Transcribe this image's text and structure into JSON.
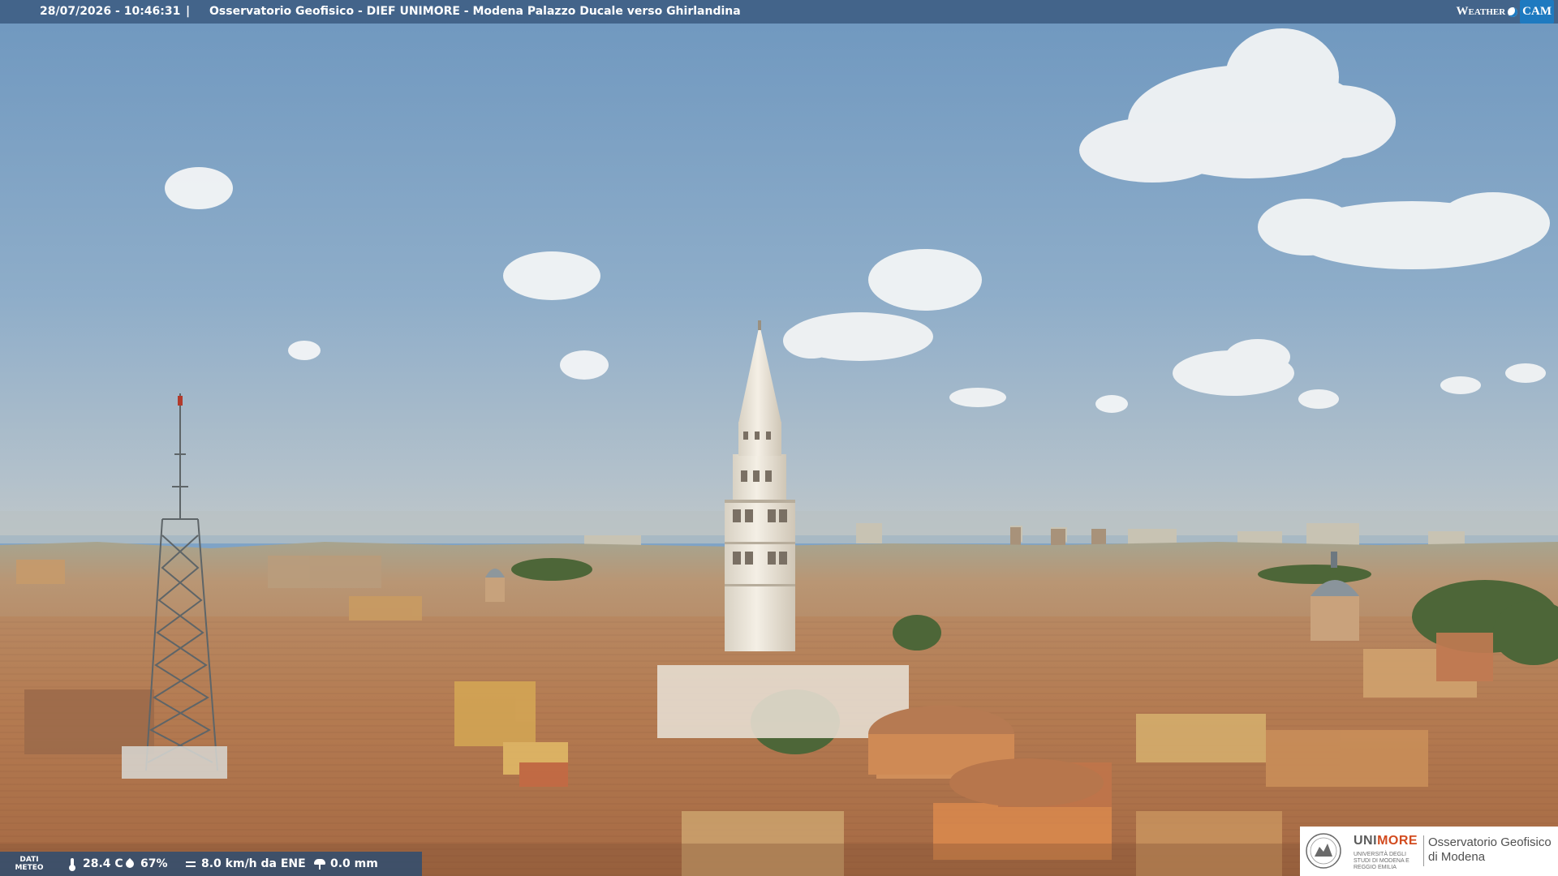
{
  "header": {
    "timestamp": "28/07/2026 - 10:46:31",
    "separator": "|",
    "caption": "Osservatorio Geofisico - DIEF UNIMORE - Modena Palazzo Ducale verso Ghirlandina"
  },
  "brand": {
    "weather": "Weather",
    "cam": "CAM"
  },
  "meteo": {
    "label": "DATI METEO",
    "temperature": "28.4 C",
    "humidity": "67%",
    "wind": "8.0 km/h da ENE",
    "rain": "0.0 mm",
    "icons": [
      "thermometer-icon",
      "humidity-drop-icon",
      "wind-icon",
      "rain-icon"
    ]
  },
  "logo": {
    "uni_prefix": "UNI",
    "uni_accent": "MORE",
    "uni_sub": "UNIVERSITÀ DEGLI STUDI DI MODENA E REGGIO EMILIA",
    "observatory_line1": "Osservatorio Geofisico",
    "observatory_line2": "di Modena"
  },
  "colors": {
    "sky_top": "#6f98c0",
    "sky_horizon": "#b8c4cc",
    "roof": "#b77a4e",
    "tower": "#ece6da",
    "header_bar": "#3f5f86",
    "unimore_accent": "#d24b1f"
  }
}
